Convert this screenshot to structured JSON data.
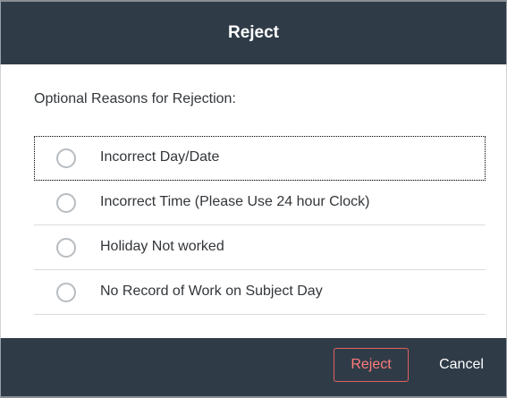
{
  "dialog": {
    "title": "Reject",
    "prompt": "Optional Reasons for Rejection:",
    "reasons": [
      {
        "label": "Incorrect Day/Date",
        "selected": false
      },
      {
        "label": "Incorrect Time (Please Use 24 hour Clock)",
        "selected": false
      },
      {
        "label": "Holiday Not worked",
        "selected": false
      },
      {
        "label": "No Record of Work on Subject Day",
        "selected": false
      }
    ],
    "buttons": {
      "reject_label": "Reject",
      "cancel_label": "Cancel"
    }
  },
  "colors": {
    "header_bg": "#2f3c48",
    "reject_accent": "#e25f5f",
    "text": "#32363a",
    "radio_border": "#b8bcc0"
  },
  "icons": {
    "radio": "radio-unchecked-icon"
  }
}
